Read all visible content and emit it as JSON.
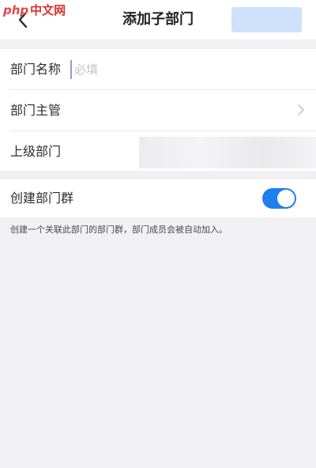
{
  "watermark": {
    "brand": "php",
    "text": "中文网"
  },
  "header": {
    "title": "添加子部门",
    "confirm_label": ""
  },
  "form": {
    "department_name": {
      "label": "部门名称",
      "placeholder": "必填",
      "value": ""
    },
    "department_manager": {
      "label": "部门主管"
    },
    "parent_department": {
      "label": "上级部门",
      "value": ""
    }
  },
  "group_chat": {
    "label": "创建部门群",
    "enabled": true,
    "hint": "创建一个关联此部门的部门群，部门成员会被自动加入。"
  },
  "colors": {
    "accent": "#1f7ef0",
    "confirm_disabled": "#cfe2fb",
    "background": "#f1f1f3"
  },
  "icons": {
    "back": "chevron-left-icon",
    "row_arrow": "chevron-right-icon"
  }
}
